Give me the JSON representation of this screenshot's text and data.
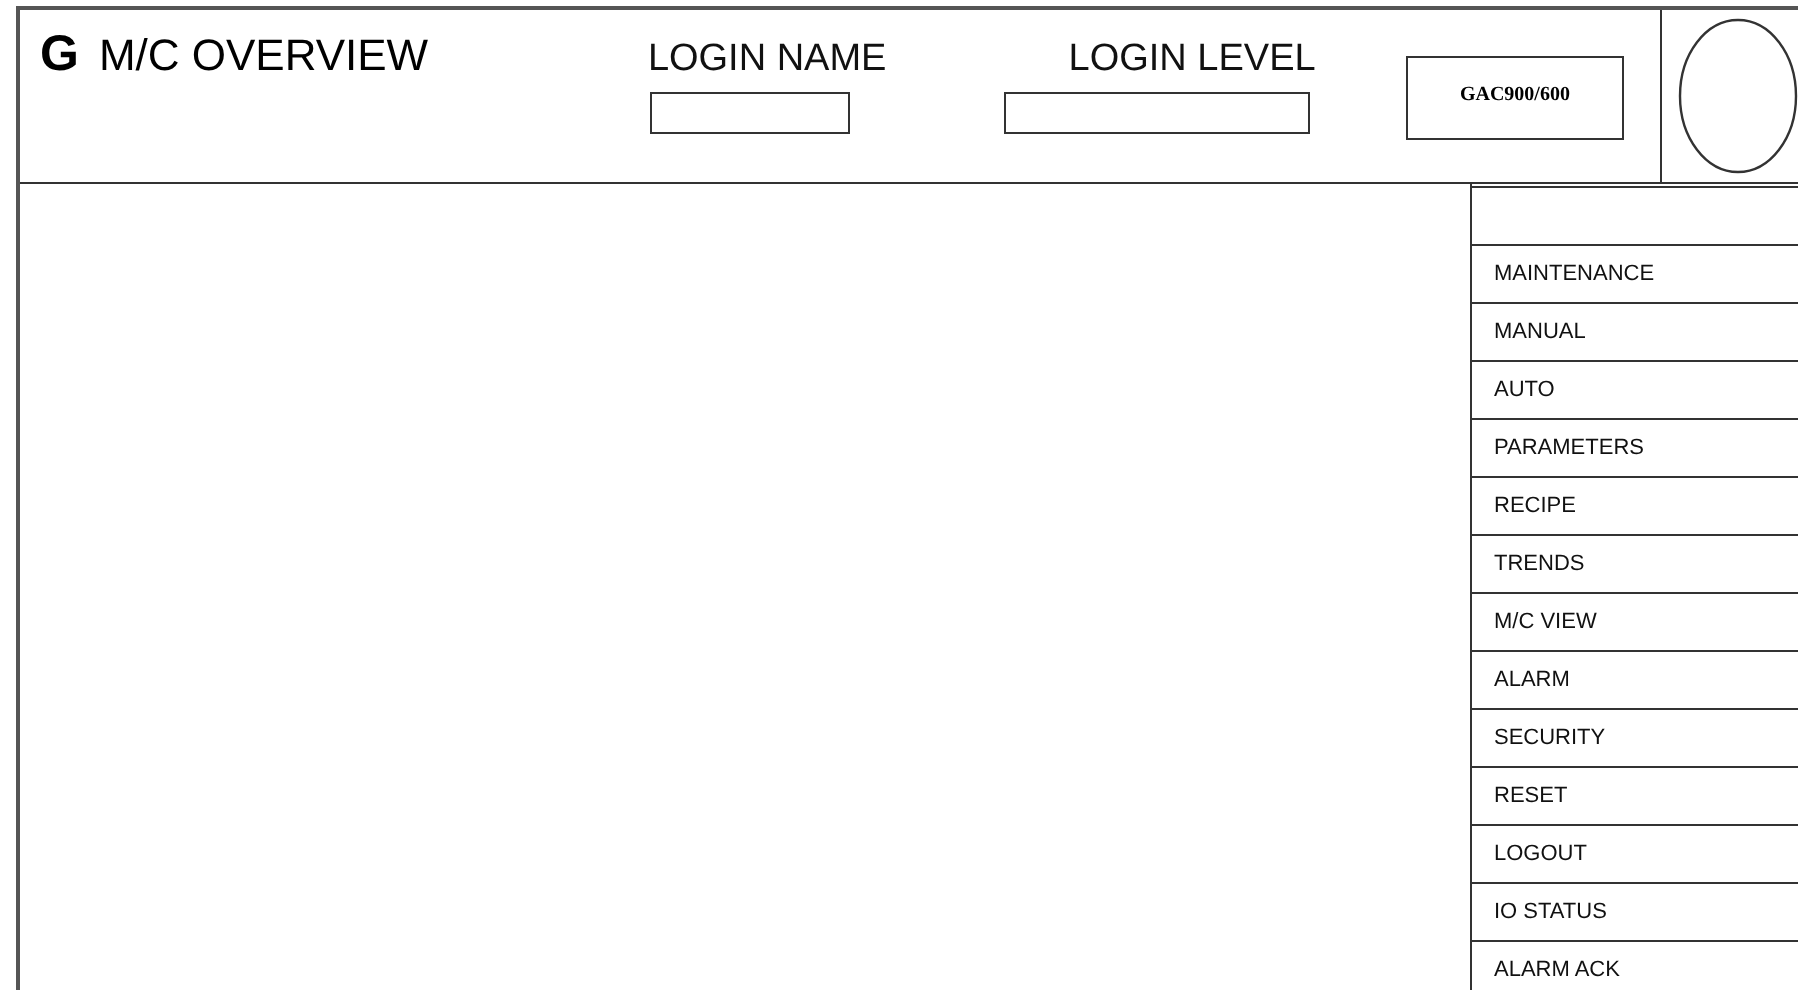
{
  "header": {
    "logo": "G",
    "title": "M/C OVERVIEW",
    "login_name": {
      "label": "LOGIN NAME"
    },
    "login_level": {
      "label": "LOGIN LEVEL"
    },
    "machine": "GAC900/600"
  },
  "menu": [
    {
      "label": "MAINTENANCE"
    },
    {
      "label": "MANUAL"
    },
    {
      "label": "AUTO"
    },
    {
      "label": "PARAMETERS"
    },
    {
      "label": "RECIPE"
    },
    {
      "label": "TRENDS"
    },
    {
      "label": "M/C VIEW"
    },
    {
      "label": "ALARM"
    },
    {
      "label": "SECURITY"
    },
    {
      "label": "RESET"
    },
    {
      "label": "LOGOUT"
    },
    {
      "label": "IO STATUS"
    },
    {
      "label": "ALARM ACK"
    }
  ]
}
